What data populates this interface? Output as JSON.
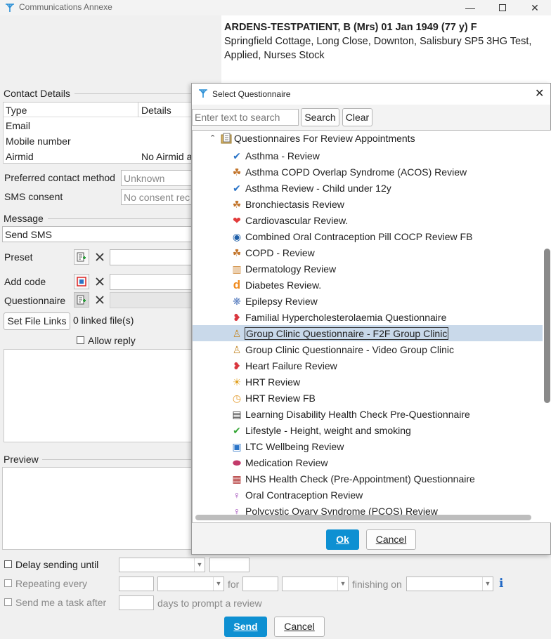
{
  "window": {
    "title": "Communications Annexe"
  },
  "patient": {
    "name_line": "ARDENS-TESTPATIENT, B (Mrs) 01 Jan 1949 (77 y) F",
    "address_line1": "Springfield Cottage, Long Close, Downton, Salisbury SP5 3HG  Test,",
    "address_line2": "Applied, Nurses Stock"
  },
  "contact": {
    "section_label": "Contact Details",
    "col_type": "Type",
    "col_details": "Details",
    "rows": [
      {
        "type": "Email",
        "details": ""
      },
      {
        "type": "Mobile number",
        "details": ""
      },
      {
        "type": "Airmid",
        "details": "No Airmid a"
      }
    ],
    "preferred_label": "Preferred contact method",
    "preferred_value": "Unknown",
    "sms_label": "SMS consent",
    "sms_value": "No consent rec"
  },
  "message": {
    "section_label": "Message",
    "mode": "Send SMS",
    "preset_label": "Preset",
    "add_code_label": "Add code",
    "questionnaire_label": "Questionnaire",
    "set_file_links": "Set File Links",
    "linked_files": "0 linked file(s)",
    "allow_reply": "Allow reply",
    "preview_label": "Preview"
  },
  "options": {
    "delay": "Delay sending until",
    "repeating": "Repeating every",
    "for": "for",
    "finishing_on": "finishing on",
    "task": "Send me a task after",
    "days_prompt": "days to prompt a review"
  },
  "footer": {
    "send": "Send",
    "cancel": "Cancel"
  },
  "dialog": {
    "title": "Select Questionnaire",
    "search_placeholder": "Enter text to search",
    "search_btn": "Search",
    "clear_btn": "Clear",
    "folder": "Questionnaires For Review Appointments",
    "items": [
      {
        "label": "Asthma - Review",
        "icon": "check-icon",
        "color": "#2b74c7"
      },
      {
        "label": "Asthma COPD Overlap Syndrome (ACOS) Review",
        "icon": "lungs-icon",
        "color": "#c2742a"
      },
      {
        "label": "Asthma Review - Child under 12y",
        "icon": "check-icon",
        "color": "#2b74c7"
      },
      {
        "label": "Bronchiectasis Review",
        "icon": "lungs-icon",
        "color": "#c2742a"
      },
      {
        "label": "Cardiovascular Review.",
        "icon": "heart-icon",
        "color": "#e23b3b"
      },
      {
        "label": "Combined Oral Contraception Pill COCP Review FB",
        "icon": "target-icon",
        "color": "#1f5fa8"
      },
      {
        "label": "COPD - Review",
        "icon": "lungs-icon",
        "color": "#c2742a"
      },
      {
        "label": "Dermatology Review",
        "icon": "skin-icon",
        "color": "#d08a3a"
      },
      {
        "label": "Diabetes Review.",
        "icon": "d-letter-icon",
        "color": "#f08a1c"
      },
      {
        "label": "Epilepsy Review",
        "icon": "brain-icon",
        "color": "#5a7fc0"
      },
      {
        "label": "Familial Hypercholesterolaemia Questionnaire",
        "icon": "broken-heart-icon",
        "color": "#d9363e"
      },
      {
        "label": "Group Clinic Questionnaire - F2F Group Clinic",
        "icon": "group-icon",
        "color": "#c48a2c"
      },
      {
        "label": "Group Clinic Questionnaire - Video Group Clinic",
        "icon": "group-icon",
        "color": "#c48a2c"
      },
      {
        "label": "Heart Failure Review",
        "icon": "broken-heart-icon",
        "color": "#d9363e"
      },
      {
        "label": "HRT Review",
        "icon": "sun-icon",
        "color": "#e0a020"
      },
      {
        "label": "HRT Review FB",
        "icon": "clock-icon",
        "color": "#e39a2a"
      },
      {
        "label": "Learning Disability Health Check Pre-Questionnaire",
        "icon": "id-card-icon",
        "color": "#333333"
      },
      {
        "label": "Lifestyle - Height, weight and smoking",
        "icon": "check-icon",
        "color": "#3aa83a"
      },
      {
        "label": "LTC Wellbeing Review",
        "icon": "clipboard-icon",
        "color": "#2b74c7"
      },
      {
        "label": "Medication Review",
        "icon": "pill-icon",
        "color": "#c23a6a"
      },
      {
        "label": "NHS Health Check (Pre-Appointment) Questionnaire",
        "icon": "certificate-icon",
        "color": "#b03030"
      },
      {
        "label": "Oral Contraception Review",
        "icon": "female-icon",
        "color": "#9b3fb5"
      },
      {
        "label": "Polycystic Ovary Syndrome (PCOS) Review",
        "icon": "female-icon",
        "color": "#9b3fb5"
      }
    ],
    "ok": "Ok",
    "cancel": "Cancel"
  }
}
